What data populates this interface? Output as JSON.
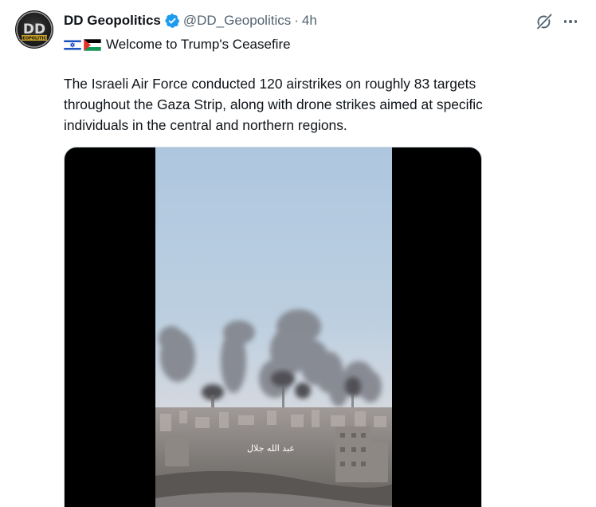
{
  "tweet": {
    "display_name": "DD Geopolitics",
    "handle": "@DD_Geopolitics",
    "separator": "·",
    "time": "4h",
    "subtitle": "Welcome to Trump's Ceasefire",
    "body_lines": [
      "The Israeli Air Force conducted 120 airstrikes on roughly 83 targets",
      "throughout the Gaza Strip, along with drone strikes aimed at specific",
      "individuals in the central and northern regions."
    ],
    "avatar_text": "DD",
    "avatar_subtext": "GEOPOLITICS",
    "video_watermark": "عبد الله جلال"
  },
  "icons": {
    "verified": "verified-badge-icon",
    "grok": "grok-icon",
    "more": "more-icon"
  },
  "colors": {
    "text_primary": "#0f1419",
    "text_secondary": "#536471",
    "verified_blue": "#1d9bf0",
    "media_background": "#000000"
  }
}
